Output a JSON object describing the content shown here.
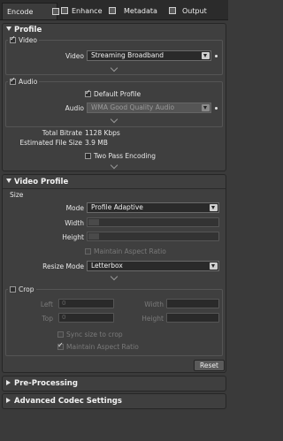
{
  "tabs": [
    {
      "label": "Encode",
      "active": true
    },
    {
      "label": "Enhance",
      "active": false
    },
    {
      "label": "Metadata",
      "active": false
    },
    {
      "label": "Output",
      "active": false
    }
  ],
  "profile": {
    "header": "Profile",
    "video": {
      "group_label": "Video",
      "checked": true,
      "field_label": "Video",
      "value": "Streaming Broadband"
    },
    "audio": {
      "group_label": "Audio",
      "checked": true,
      "default_profile_label": "Default Profile",
      "default_profile_checked": true,
      "field_label": "Audio",
      "value": "WMA Good Quality Audio"
    },
    "total_bitrate_label": "Total Bitrate",
    "total_bitrate_value": "1128 Kbps",
    "estimated_size_label": "Estimated File Size",
    "estimated_size_value": "3.9 MB",
    "two_pass_label": "Two Pass Encoding",
    "two_pass_checked": false
  },
  "video_profile": {
    "header": "Video Profile",
    "size_label": "Size",
    "mode_label": "Mode",
    "mode_value": "Profile Adaptive",
    "width_label": "Width",
    "height_label": "Height",
    "maintain_aspect_label": "Maintain Aspect Ratio",
    "resize_mode_label": "Resize Mode",
    "resize_mode_value": "Letterbox",
    "crop": {
      "label": "Crop",
      "checked": false,
      "left_label": "Left",
      "left_value": "0",
      "top_label": "Top",
      "top_value": "0",
      "width_label": "Width",
      "height_label": "Height",
      "sync_label": "Sync size to crop",
      "maintain_label": "Maintain Aspect Ratio"
    },
    "reset_label": "Reset"
  },
  "pre_processing": {
    "header": "Pre-Processing"
  },
  "advanced_codec": {
    "header": "Advanced Codec Settings"
  },
  "colors": {
    "panel": "#3f3f3f",
    "background": "#3a3a3a",
    "field": "#2a2a2a"
  }
}
